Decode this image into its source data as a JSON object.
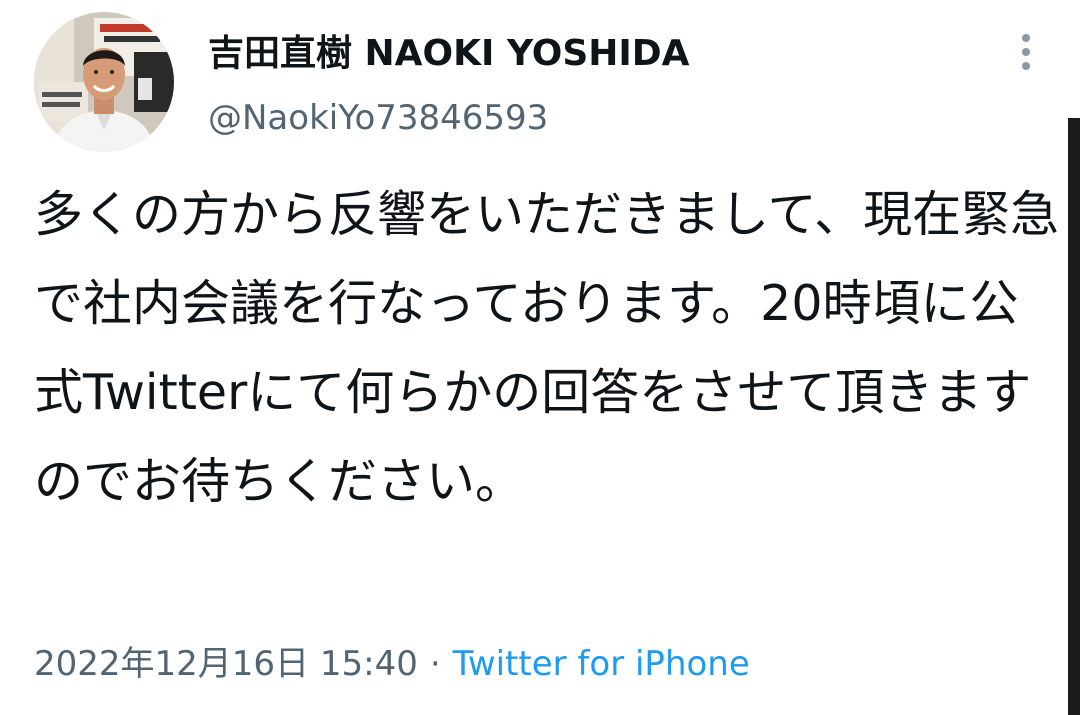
{
  "author": {
    "display_name": "吉田直樹 NAOKI YOSHIDA",
    "handle": "@NaokiYo73846593",
    "avatar_icon": "profile-photo"
  },
  "tweet": {
    "text": "多くの方から反響をいただきまして、現在緊急で社内会議を行なっております。20時頃に公式Twitterにて何らかの回答をさせて頂きますのでお待ちください。"
  },
  "meta": {
    "timestamp": "2022年12月16日 15:40",
    "separator": "·",
    "source": "Twitter for iPhone"
  },
  "icons": {
    "more": "more-vertical-icon"
  },
  "colors": {
    "primary_text": "#0f1419",
    "secondary_text": "#536471",
    "link": "#1d9bf0"
  }
}
